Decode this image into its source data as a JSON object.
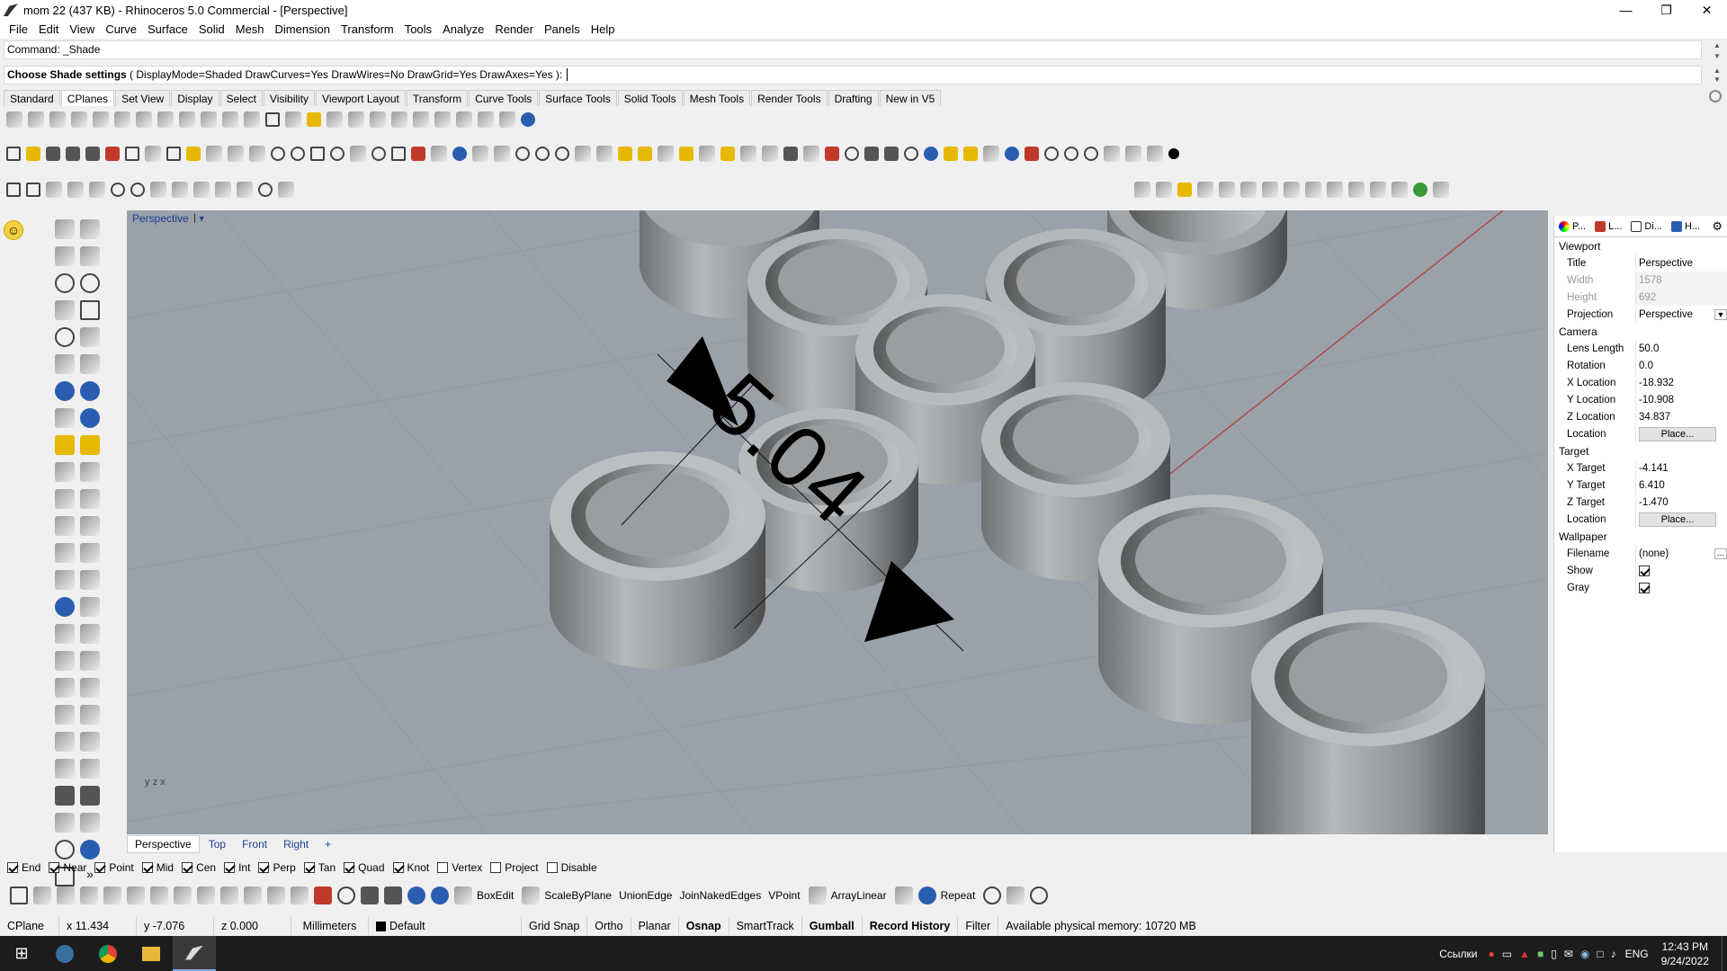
{
  "window": {
    "title": "mom 22 (437 KB) - Rhinoceros 5.0 Commercial - [Perspective]"
  },
  "menu": [
    "File",
    "Edit",
    "View",
    "Curve",
    "Surface",
    "Solid",
    "Mesh",
    "Dimension",
    "Transform",
    "Tools",
    "Analyze",
    "Render",
    "Panels",
    "Help"
  ],
  "command": {
    "history": "Command: _Shade",
    "prompt_bold": "Choose Shade settings",
    "prompt_options": " ( DisplayMode=Shaded  DrawCurves=Yes  DrawWires=No  DrawGrid=Yes  DrawAxes=Yes ): "
  },
  "toolbar_tabs": [
    "Standard",
    "CPlanes",
    "Set View",
    "Display",
    "Select",
    "Visibility",
    "Viewport Layout",
    "Transform",
    "Curve Tools",
    "Surface Tools",
    "Solid Tools",
    "Mesh Tools",
    "Render Tools",
    "Drafting",
    "New in V5"
  ],
  "viewport": {
    "label": "Perspective",
    "dimension_text": "5.04",
    "axis_labels": {
      "x": "x",
      "y": "y",
      "z": "z"
    },
    "tabs": [
      "Perspective",
      "Top",
      "Front",
      "Right"
    ],
    "add_tab_symbol": "+"
  },
  "panel": {
    "tabs": [
      "P...",
      "L...",
      "Di...",
      "H..."
    ],
    "viewport_section": "Viewport",
    "title_key": "Title",
    "title_val": "Perspective",
    "width_key": "Width",
    "width_val": "1578",
    "height_key": "Height",
    "height_val": "692",
    "projection_key": "Projection",
    "projection_val": "Perspective",
    "camera_section": "Camera",
    "lens_key": "Lens Length",
    "lens_val": "50.0",
    "rotation_key": "Rotation",
    "rotation_val": "0.0",
    "xloc_key": "X Location",
    "xloc_val": "-18.932",
    "yloc_key": "Y Location",
    "yloc_val": "-10.908",
    "zloc_key": "Z Location",
    "zloc_val": "34.837",
    "location_key": "Location",
    "place_label": "Place...",
    "target_section": "Target",
    "xt_key": "X Target",
    "xt_val": "-4.141",
    "yt_key": "Y Target",
    "yt_val": "6.410",
    "zt_key": "Z Target",
    "zt_val": "-1.470",
    "wallpaper_section": "Wallpaper",
    "filename_key": "Filename",
    "filename_val": "(none)",
    "filename_btn": "...",
    "show_key": "Show",
    "show_checked": true,
    "gray_key": "Gray",
    "gray_checked": true
  },
  "osnaps": [
    {
      "label": "End",
      "checked": true
    },
    {
      "label": "Near",
      "checked": true
    },
    {
      "label": "Point",
      "checked": true
    },
    {
      "label": "Mid",
      "checked": true
    },
    {
      "label": "Cen",
      "checked": true
    },
    {
      "label": "Int",
      "checked": true
    },
    {
      "label": "Perp",
      "checked": true
    },
    {
      "label": "Tan",
      "checked": true
    },
    {
      "label": "Quad",
      "checked": true
    },
    {
      "label": "Knot",
      "checked": true
    },
    {
      "label": "Vertex",
      "checked": false
    },
    {
      "label": "Project",
      "checked": false
    },
    {
      "label": "Disable",
      "checked": false
    }
  ],
  "bottom_toolbar": {
    "boxedit": "BoxEdit",
    "scalebyplane": "ScaleByPlane",
    "unionedge": "UnionEdge",
    "joinnaked": "JoinNakedEdges",
    "vpoint": "VPoint",
    "arraylinear": "ArrayLinear",
    "repeat": "Repeat"
  },
  "status": {
    "cplane": "CPlane",
    "x": "x 11.434",
    "y": "y -7.076",
    "z": "z 0.000",
    "units": "Millimeters",
    "layer": "Default",
    "gridsnap": "Grid Snap",
    "ortho": "Ortho",
    "planar": "Planar",
    "osnap": "Osnap",
    "smarttrack": "SmartTrack",
    "gumball": "Gumball",
    "record": "Record History",
    "filter": "Filter",
    "memory": "Available physical memory: 10720 MB"
  },
  "taskbar": {
    "links": "Ссылки",
    "lang": "ENG",
    "time": "12:43 PM",
    "date": "9/24/2022"
  }
}
